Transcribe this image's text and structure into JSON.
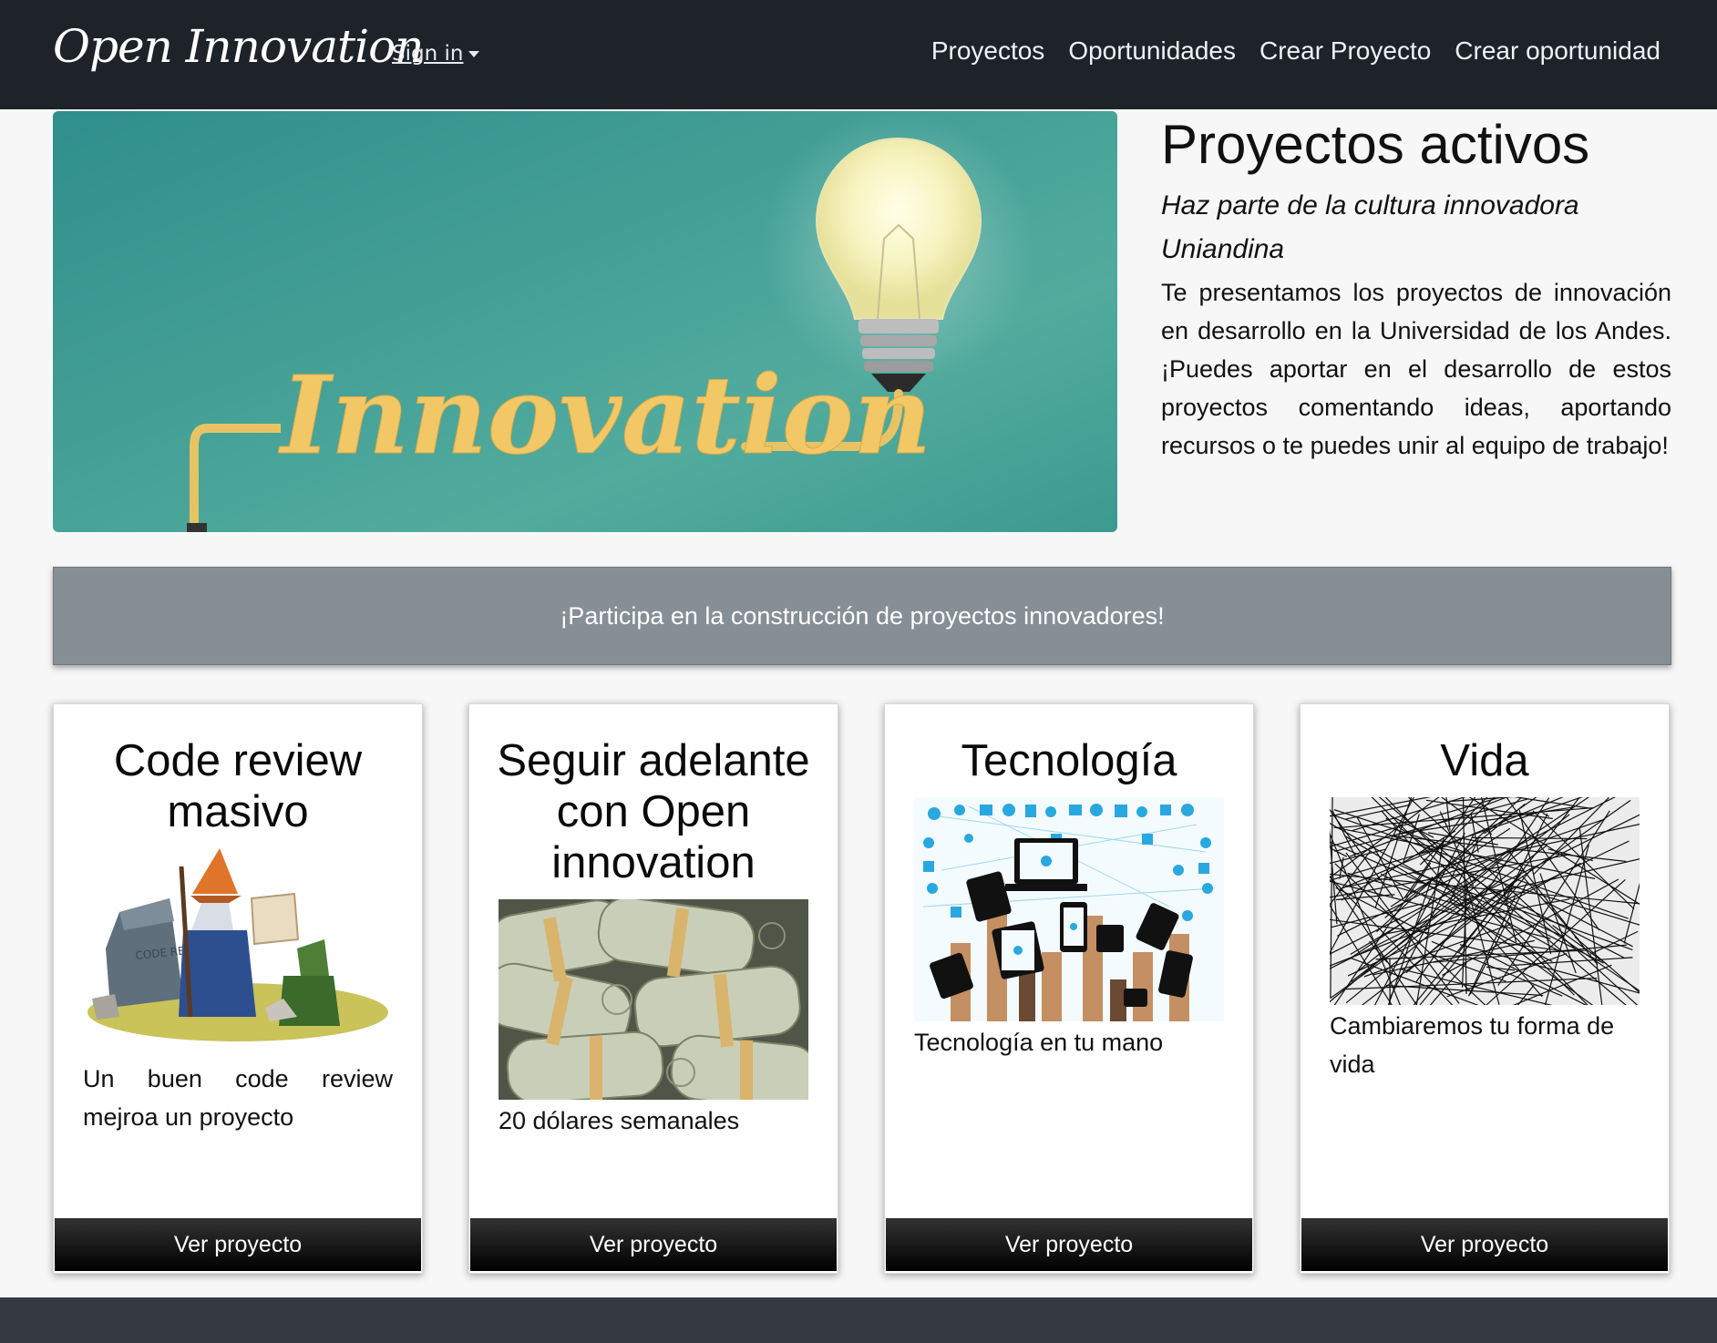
{
  "navbar": {
    "brand": "Open Innovation",
    "signin": "Sign in",
    "links": [
      "Proyectos",
      "Oportunidades",
      "Crear Proyecto",
      "Crear oportunidad"
    ]
  },
  "hero": {
    "image_text": "Innovation",
    "title": "Proyectos activos",
    "tagline": "Haz parte de la cultura innovadora Uniandina",
    "description": "Te presentamos los proyectos de innovación en desarrollo en la Universidad de los Andes. ¡Puedes aportar en el desarrollo de estos proyectos comentando ideas, aportando recursos o te puedes unir al equipo de trabajo!"
  },
  "banner": {
    "text": "¡Participa en la construcción de proyectos innovadores!"
  },
  "cards": [
    {
      "title": "Code review masivo",
      "image": "wizard-code-review",
      "image_text": "CODE REVIEW",
      "text": "Un buen code review mejroa un proyecto",
      "button": "Ver proyecto"
    },
    {
      "title": "Seguir adelante con Open innovation",
      "image": "money-rolls",
      "text": "20 dólares semanales",
      "button": "Ver proyecto"
    },
    {
      "title": "Tecnología",
      "image": "tech-hands",
      "text": "Tecnología en tu mano",
      "button": "Ver proyecto"
    },
    {
      "title": "Vida",
      "image": "black-lines",
      "text": "Cambiaremos tu forma de vida",
      "button": "Ver proyecto"
    }
  ],
  "colors": {
    "navbar": "#1d2329",
    "banner": "#868e96",
    "footer": "#343a40",
    "hero_teal": "#3a9c94"
  }
}
